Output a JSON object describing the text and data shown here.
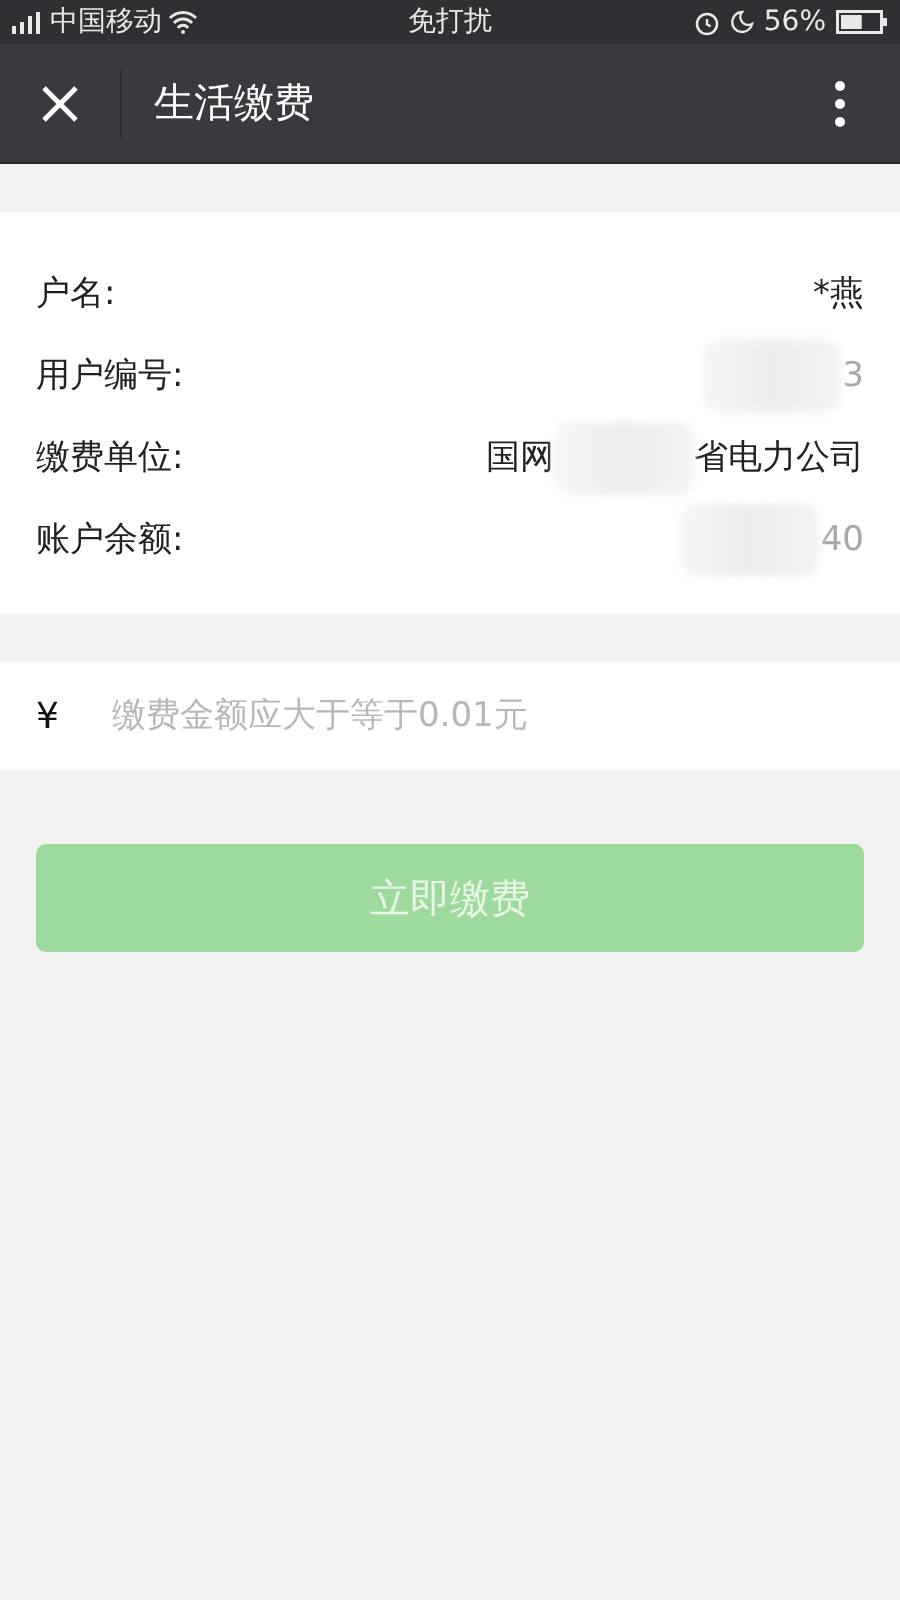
{
  "status_bar": {
    "carrier": "中国移动",
    "center": "免打扰",
    "battery_text": "56%",
    "battery": {
      "level": 0.56
    }
  },
  "nav": {
    "title": "生活缴费"
  },
  "info_rows": [
    {
      "label": "户名:",
      "value": [
        {
          "kind": "text",
          "text": "*燕"
        }
      ]
    },
    {
      "label": "用户编号:",
      "value": [
        {
          "kind": "redacted"
        },
        {
          "kind": "faded",
          "text": "3"
        }
      ]
    },
    {
      "label": "缴费单位:",
      "value": [
        {
          "kind": "text",
          "text": "国网"
        },
        {
          "kind": "redacted"
        },
        {
          "kind": "text",
          "text": "省电力公司"
        }
      ]
    },
    {
      "label": "账户余额:",
      "value": [
        {
          "kind": "redacted"
        },
        {
          "kind": "faded",
          "text": "40"
        }
      ]
    }
  ],
  "amount": {
    "currency": "¥",
    "placeholder": "缴费金额应大于等于0.01元"
  },
  "pay_button": {
    "label": "立即缴费",
    "disabled": true
  }
}
